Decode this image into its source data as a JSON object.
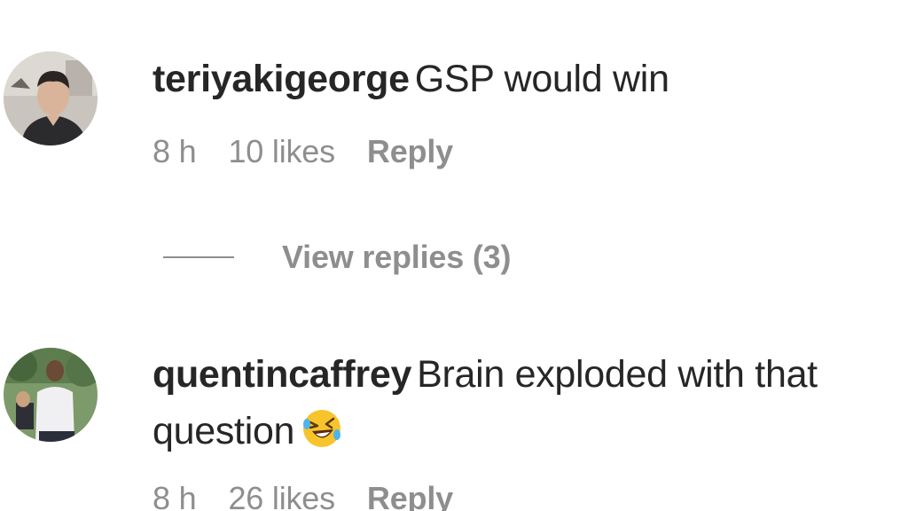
{
  "comments": [
    {
      "username": "teriyakigeorge",
      "text": "GSP would win",
      "time": "8 h",
      "likes": "10 likes",
      "reply_label": "Reply",
      "avatar_icon": "user-avatar-photo"
    },
    {
      "username": "quentincaffrey",
      "text": "Brain exploded with that",
      "text_line2": "question",
      "emoji": "rolling-on-floor-laughing-emoji",
      "time": "8 h",
      "likes": "26 likes",
      "reply_label": "Reply",
      "avatar_icon": "user-avatar-photo"
    }
  ],
  "view_replies": {
    "label": "View replies (3)"
  },
  "colors": {
    "text_primary": "#262626",
    "text_secondary": "#8e8e8e",
    "background": "#ffffff"
  }
}
